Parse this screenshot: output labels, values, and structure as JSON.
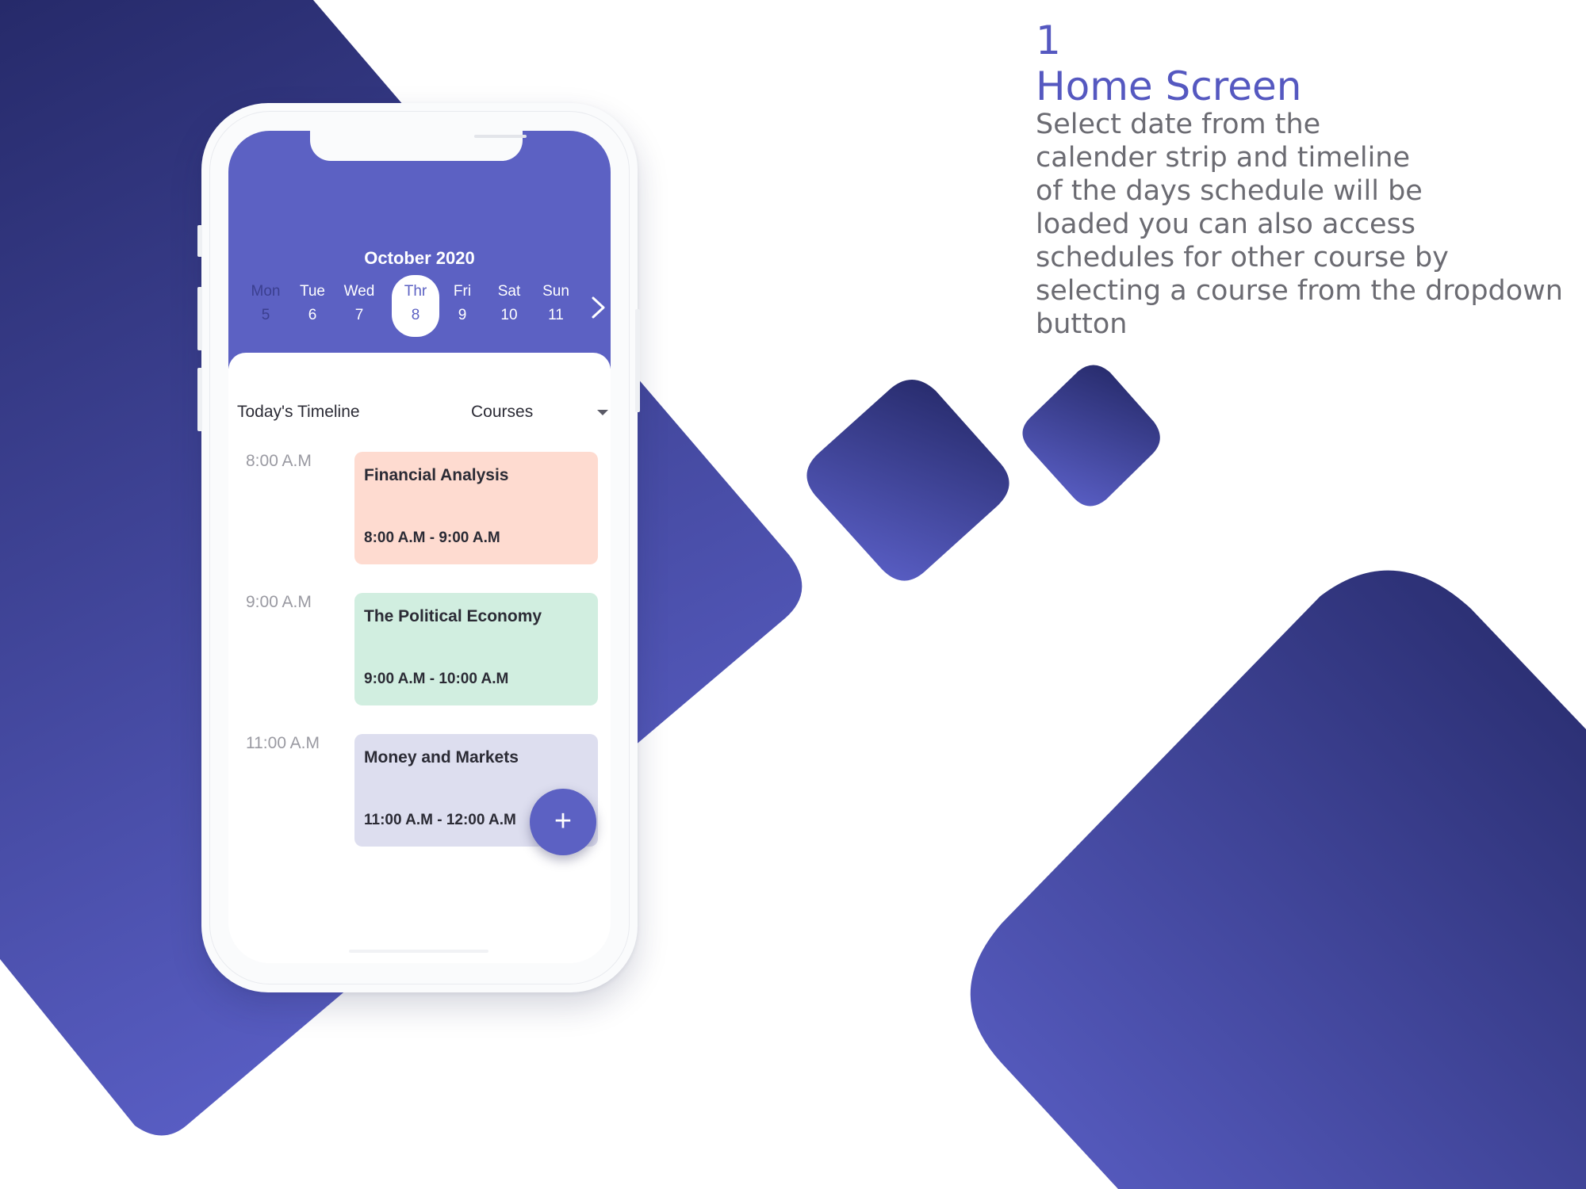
{
  "colors": {
    "brand": "#5c61c3",
    "decor_dark": "#262a6a",
    "decor_light": "#5a5fc6",
    "event_1": "#fedbd0",
    "event_2": "#d1eee0",
    "event_3": "#dddeef"
  },
  "app": {
    "month_label": "October 2020",
    "days": [
      {
        "name": "Mon",
        "date": "5"
      },
      {
        "name": "Tue",
        "date": "6"
      },
      {
        "name": "Wed",
        "date": "7"
      },
      {
        "name": "Thr",
        "date": "8"
      },
      {
        "name": "Fri",
        "date": "9"
      },
      {
        "name": "Sat",
        "date": "10"
      },
      {
        "name": "Sun",
        "date": "11"
      }
    ],
    "next_icon": "chevron-right-icon",
    "timeline_title": "Today's Timeline",
    "courses_dropdown": "Courses",
    "dropdown_icon": "caret-down-icon",
    "times": [
      "8:00 A.M",
      "9:00 A.M",
      "11:00 A.M"
    ],
    "events": [
      {
        "title": "Financial Analysis",
        "range": "8:00 A.M - 9:00 A.M"
      },
      {
        "title": "The Political Economy",
        "range": "9:00 A.M - 10:00 A.M"
      },
      {
        "title": "Money and Markets",
        "range": "11:00 A.M - 12:00 A.M"
      }
    ],
    "fab_label": "+",
    "fab_icon": "plus-icon"
  },
  "caption": {
    "number": "1",
    "title": "Home Screen",
    "lines": [
      "Select date from the",
      "calender strip and timeline",
      "of the days schedule will be",
      "loaded you can also access",
      "schedules for other course by",
      "selecting a course from the dropdown",
      "button"
    ]
  }
}
